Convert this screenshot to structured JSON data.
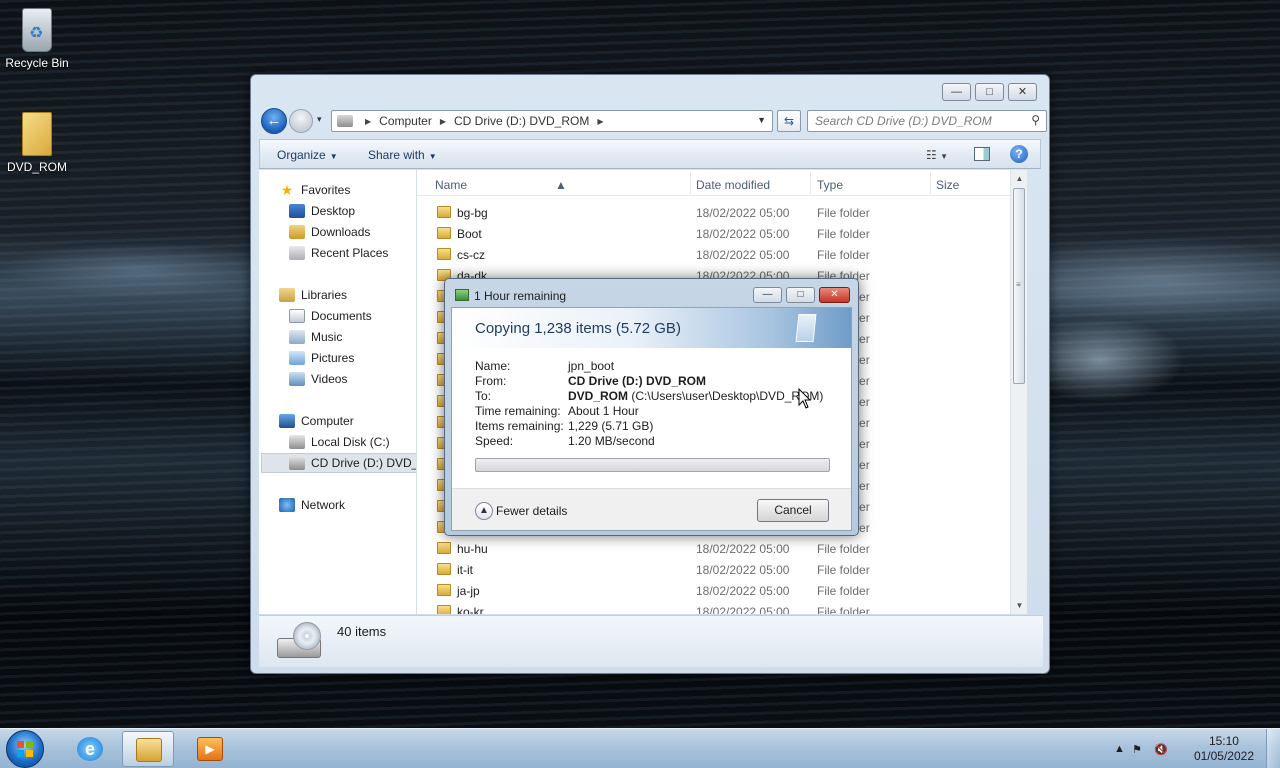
{
  "desktop": {
    "icons": [
      {
        "label": "Recycle Bin",
        "icon": "recycle-bin-icon"
      },
      {
        "label": "DVD_ROM",
        "icon": "folder-icon"
      }
    ]
  },
  "explorer": {
    "window_buttons": {
      "minimize": "—",
      "maximize": "□",
      "close": "✕"
    },
    "nav": {
      "back": "←",
      "forward": "→",
      "history": "▾"
    },
    "breadcrumb": [
      "Computer",
      "CD Drive (D:) DVD_ROM"
    ],
    "search_placeholder": "Search CD Drive (D:) DVD_ROM",
    "toolbar": {
      "organize": "Organize",
      "share_with": "Share with"
    },
    "nav_pane": {
      "favorites_label": "Favorites",
      "favorites": [
        "Desktop",
        "Downloads",
        "Recent Places"
      ],
      "libraries_label": "Libraries",
      "libraries": [
        "Documents",
        "Music",
        "Pictures",
        "Videos"
      ],
      "computer_label": "Computer",
      "drives": [
        "Local Disk (C:)",
        "CD Drive (D:) DVD_ROM"
      ],
      "network_label": "Network"
    },
    "columns": {
      "name": "Name",
      "date_modified": "Date modified",
      "type": "Type",
      "size": "Size"
    },
    "files": [
      {
        "name": "bg-bg",
        "date": "18/02/2022 05:00",
        "type": "File folder"
      },
      {
        "name": "Boot",
        "date": "18/02/2022 05:00",
        "type": "File folder"
      },
      {
        "name": "cs-cz",
        "date": "18/02/2022 05:00",
        "type": "File folder"
      },
      {
        "name": "da-dk",
        "date": "18/02/2022 05:00",
        "type": "File folder"
      }
    ],
    "files_bottom": [
      {
        "name": "hu-hu",
        "date": "18/02/2022 05:00",
        "type": "File folder"
      },
      {
        "name": "it-it",
        "date": "18/02/2022 05:00",
        "type": "File folder"
      },
      {
        "name": "ja-jp",
        "date": "18/02/2022 05:00",
        "type": "File folder"
      },
      {
        "name": "ko-kr",
        "date": "18/02/2022 05:00",
        "type": "File folder"
      }
    ],
    "hidden_row_meta": {
      "date": "18/02/2022 05:00",
      "type": "File folder"
    },
    "status": {
      "item_count": "40 items"
    }
  },
  "copy_dialog": {
    "title": "1 Hour remaining",
    "heading": "Copying 1,238 items (5.72 GB)",
    "fields": {
      "name_key": "Name:",
      "name_val": "jpn_boot",
      "from_key": "From:",
      "from_val": "CD Drive (D:) DVD_ROM",
      "to_key": "To:",
      "to_bold": "DVD_ROM",
      "to_path": "(C:\\Users\\user\\Desktop\\DVD_ROM)",
      "time_key": "Time remaining:",
      "time_val": "About 1 Hour",
      "items_key": "Items remaining:",
      "items_val": "1,229 (5.71 GB)",
      "speed_key": "Speed:",
      "speed_val": "1.20 MB/second"
    },
    "progress_fraction": 0.0,
    "fewer_details": "Fewer details",
    "cancel": "Cancel"
  },
  "taskbar": {
    "apps": [
      "internet-explorer",
      "windows-explorer",
      "windows-media-player"
    ],
    "time": "15:10",
    "date": "01/05/2022"
  }
}
